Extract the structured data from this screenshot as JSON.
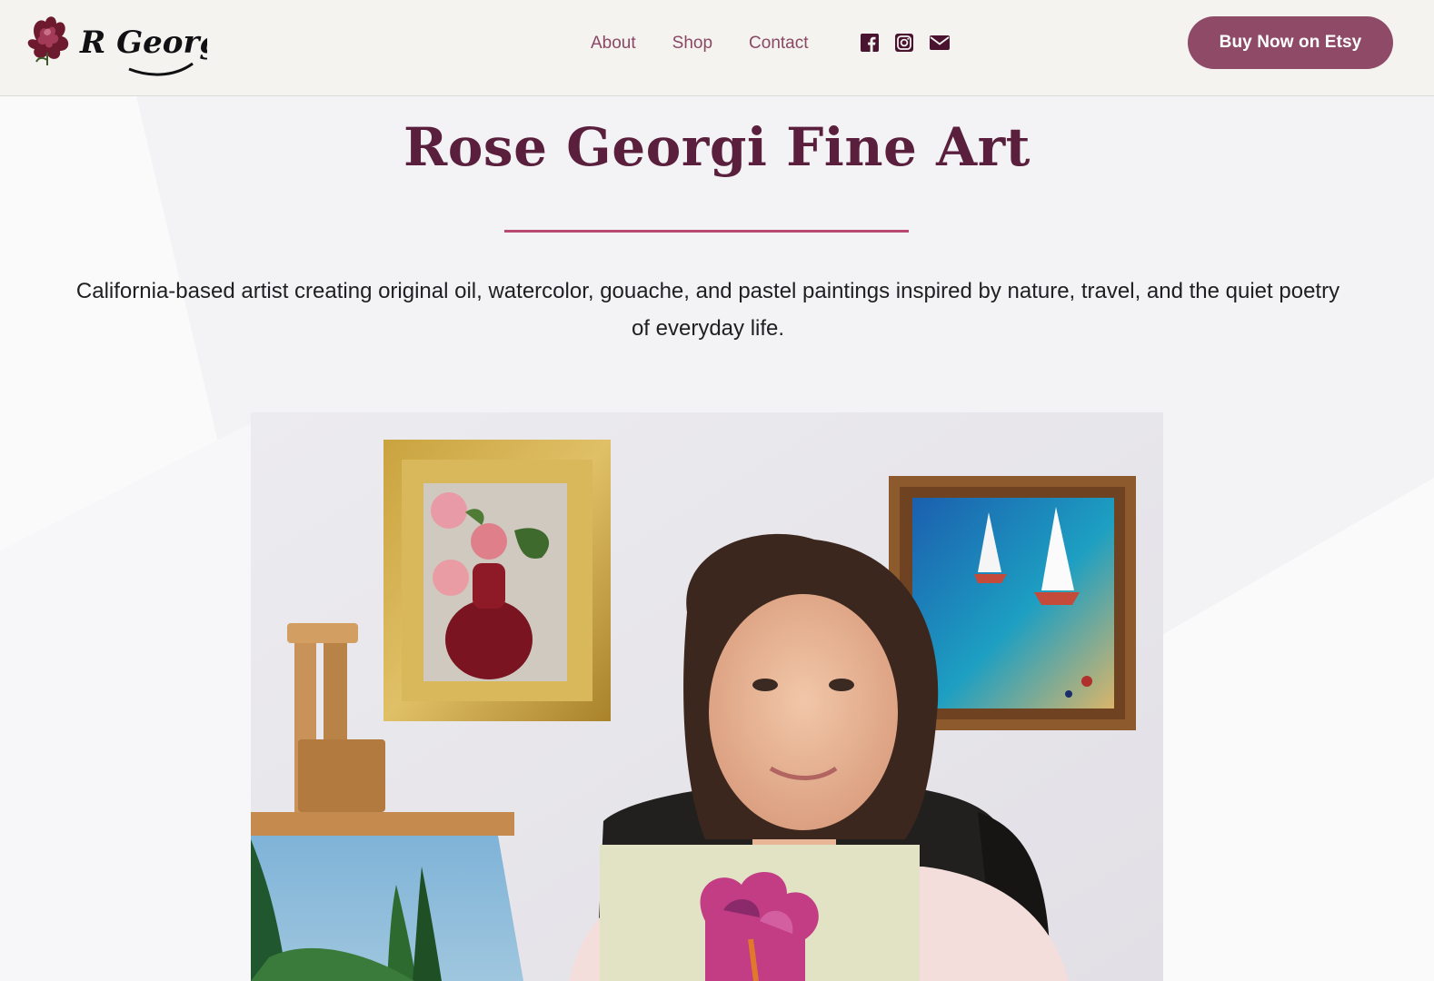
{
  "header": {
    "logo_text": "R Georgi",
    "nav": [
      {
        "label": "About"
      },
      {
        "label": "Shop"
      },
      {
        "label": "Contact"
      }
    ],
    "social_icons": [
      "facebook-icon",
      "instagram-icon",
      "email-icon"
    ],
    "cta_label": "Buy Now on Etsy"
  },
  "hero": {
    "title": "Rose Georgi Fine Art",
    "tagline": "California-based artist creating original oil, watercolor, gouache, and pastel paintings inspired by nature, travel, and the quiet poetry of everyday life."
  },
  "colors": {
    "accent": "#8e4a67",
    "title": "#5a1f3c",
    "divider": "#b84a72",
    "header_bg": "#f4f3f0"
  }
}
